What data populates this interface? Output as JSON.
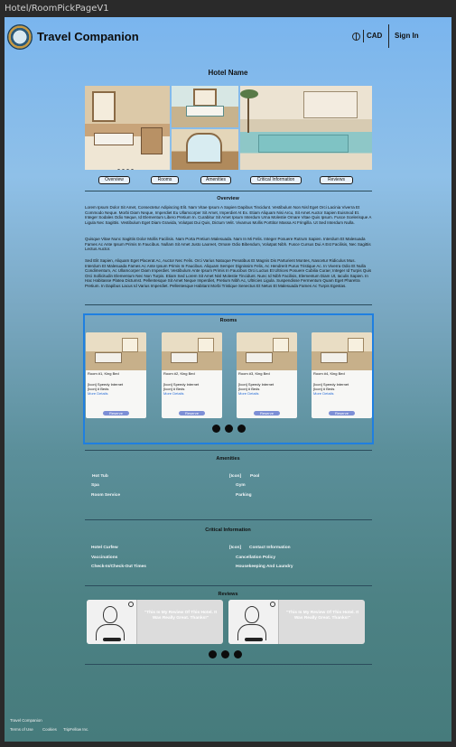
{
  "frame": {
    "title": "Hotel/RoomPickPageV1"
  },
  "nav": {
    "brand": "Travel Companion",
    "currency": "CAD",
    "sign_in": "Sign In"
  },
  "hotel": {
    "name": "Hotel Name"
  },
  "tabs": [
    "Overview",
    "Rooms",
    "Amenities",
    "Critical Information",
    "Reviews"
  ],
  "overview": {
    "title": "Overview",
    "paragraphs": [
      "Lorem Ipsum Dolor Sit Amet, Consectetur Adipiscing Elit. Nam Vitae Ipsum A Sapien Dapibus Tincidunt. Vestibulum Non Nisl Eget Orci Lacinia Viverra Et Commodo Neque. Morbi Diam Neque, Imperdiet Eu Ullamcorper Sit Amet, Imperdiet At Ex. Etiam Aliquam Nisi Arcu, Sit Amet Auctor Sapien Euismod Et. Integer Sodales Odio Neque, Id Elementum Libero Pretium In. Curabitur Sit Amet Ipsum Interdum Urna Molestie Ornare Vitae Quis Ipsum. Fusce Scelerisque A Ligula Nec Sagittis. Vestibulum Eget Diam Gravida, Volutpat Dui Quis, Dictum Velit. Vivamus Mollis Porttitor Massa At Fringilla. Ut Sed Interdum Nulla.",
      "Quisque Vitae Nunc Sagittis Dolor Mollis Facilisis. Nam Porta Pretium Malesuada. Nam In Mi Felis. Integer Posuere Rutrum Sapien. Interdum Et Malesuada Fames Ac Ante Ipsum Primis In Faucibus. Nullam Sit Amet Justo Laoreet, Ornare Odio Bibendum, Volutpat Nibh. Fusce Cursus Dui A Est Facilisis, Nec Sagittis Lectus Auctor.",
      "Sed Elit Sapien, Aliquam Eget Placerat Ac, Auctor Nec Felis. Orci Varius Natoque Penatibus Et Magnis Dis Parturient Montes, Nascetur Ridiculus Mus. Interdum Et Malesuada Fames Ac Ante Ipsum Primis In Faucibus. Aliquam Semper Dignissim Felis, Ac Hendrerit Purus Tristique Ac. In Viverra Odio Et Nulla Condimentum, Ac Ullamcorper Diam Imperdiet. Vestibulum Ante Ipsum Primis In Faucibus Orci Luctus Et Ultrices Posuere Cubilia Curae; Integer Id Turpis Quis Orci Sollicitudin Elementum Nec Non Turpis. Etiam Sed Lorem Sit Amet Nisl Molestie Tincidunt. Nunc Id Nibh Facilisis, Elementum Diam Ut, Iaculis Sapien. In Hac Habitasse Platea Dictumst. Pellentesque Sit Amet Neque Imperdiet, Pretium Nibh Ac, Ultricies Ligula. Suspendisse Fermentum Quam Eget Pharetra Pretium. In Dapibus Lacus Id Varius Imperdiet. Pellentesque Habitant Morbi Tristique Senectus Et Netus Et Malesuada Fames Ac Turpis Egestas."
    ]
  },
  "rooms": {
    "title": "Rooms",
    "items": [
      {
        "name": "Room #1, King Bed",
        "internet": "[Icon] Speedy Internet",
        "beds": "[Icon] # Beds",
        "more": "More Details",
        "reserve": "Reserve"
      },
      {
        "name": "Room #2, King Bed",
        "internet": "[Icon] Speedy Internet",
        "beds": "[Icon] # Beds",
        "more": "More Details",
        "reserve": "Reserve"
      },
      {
        "name": "Room #3, King Bed",
        "internet": "[Icon] Speedy Internet",
        "beds": "[Icon] # Beds",
        "more": "More Details",
        "reserve": "Reserve"
      },
      {
        "name": "Room #4, King Bed",
        "internet": "[Icon] Speedy Internet",
        "beds": "[Icon] # Beds",
        "more": "More Details",
        "reserve": "Reserve"
      }
    ]
  },
  "amenities": {
    "title": "Amenities",
    "left": [
      "Hot Tub",
      "Spa",
      "Room Service"
    ],
    "right_icon": "[Icon]",
    "right": [
      "Pool",
      "Gym",
      "Parking"
    ]
  },
  "critical": {
    "title": "Critical Information",
    "left": [
      "Hotel Curfew",
      "Vaccinations",
      "Check-In/Check-Out Times"
    ],
    "right_icon": "[Icon]",
    "right": [
      "Contact Information",
      "Cancellation Policy",
      "Housekeeping And Laundry"
    ]
  },
  "reviews": {
    "title": "Reviews",
    "items": [
      {
        "text": "\"This Is My Review Of This Hotel. It Was Really Great. Thanks!\""
      },
      {
        "text": "\"This Is My Review Of This Hotel. It Was Really Great. Thanks!\""
      }
    ]
  },
  "footer": {
    "brand": "Travel Companion",
    "links": [
      "Terms of Use",
      "Cookies",
      "TripFellow Inc."
    ]
  }
}
